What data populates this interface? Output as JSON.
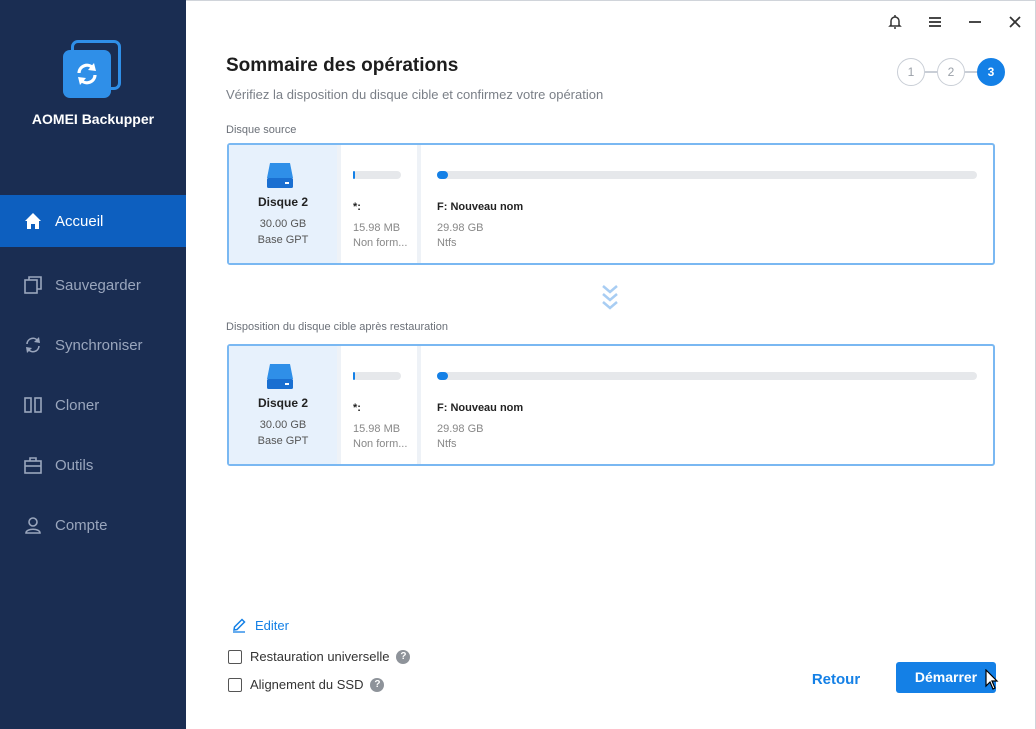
{
  "app": {
    "name": "AOMEI Backupper"
  },
  "sidebar": {
    "items": [
      {
        "label": "Accueil",
        "icon": "home-icon",
        "active": true
      },
      {
        "label": "Sauvegarder",
        "icon": "backup-icon",
        "active": false
      },
      {
        "label": "Synchroniser",
        "icon": "sync-icon",
        "active": false
      },
      {
        "label": "Cloner",
        "icon": "clone-icon",
        "active": false
      },
      {
        "label": "Outils",
        "icon": "tools-icon",
        "active": false
      },
      {
        "label": "Compte",
        "icon": "user-icon",
        "active": false
      }
    ]
  },
  "titlebar": {
    "icons": [
      "bell-icon",
      "menu-icon",
      "minimize-icon",
      "close-icon"
    ]
  },
  "page": {
    "title": "Sommaire des opérations",
    "subtitle": "Vérifiez la disposition du disque cible et confirmez votre opération"
  },
  "steps": {
    "items": [
      "1",
      "2",
      "3"
    ],
    "current": 3
  },
  "source": {
    "label": "Disque source",
    "disk": {
      "name": "Disque 2",
      "size": "30.00 GB",
      "type": "Base GPT"
    },
    "partitions": [
      {
        "name": "*:",
        "size": "15.98 MB",
        "fs": "Non form...",
        "used_fraction": 0.05
      },
      {
        "name": "F: Nouveau nom",
        "size": "29.98 GB",
        "fs": "Ntfs",
        "used_fraction": 0.02
      }
    ]
  },
  "target": {
    "label": "Disposition du disque cible après restauration",
    "disk": {
      "name": "Disque 2",
      "size": "30.00 GB",
      "type": "Base GPT"
    },
    "partitions": [
      {
        "name": "*:",
        "size": "15.98 MB",
        "fs": "Non form...",
        "used_fraction": 0.05
      },
      {
        "name": "F: Nouveau nom",
        "size": "29.98 GB",
        "fs": "Ntfs",
        "used_fraction": 0.02
      }
    ]
  },
  "options": {
    "edit_label": "Editer",
    "universal_restore": {
      "label": "Restauration universelle",
      "checked": false
    },
    "ssd_alignment": {
      "label": "Alignement du SSD",
      "checked": false
    },
    "help_glyph": "?"
  },
  "buttons": {
    "back": "Retour",
    "start": "Démarrer"
  },
  "colors": {
    "accent": "#1480e6",
    "sidebar": "#1a2d52",
    "sidebar_active": "#0d5fbf"
  }
}
